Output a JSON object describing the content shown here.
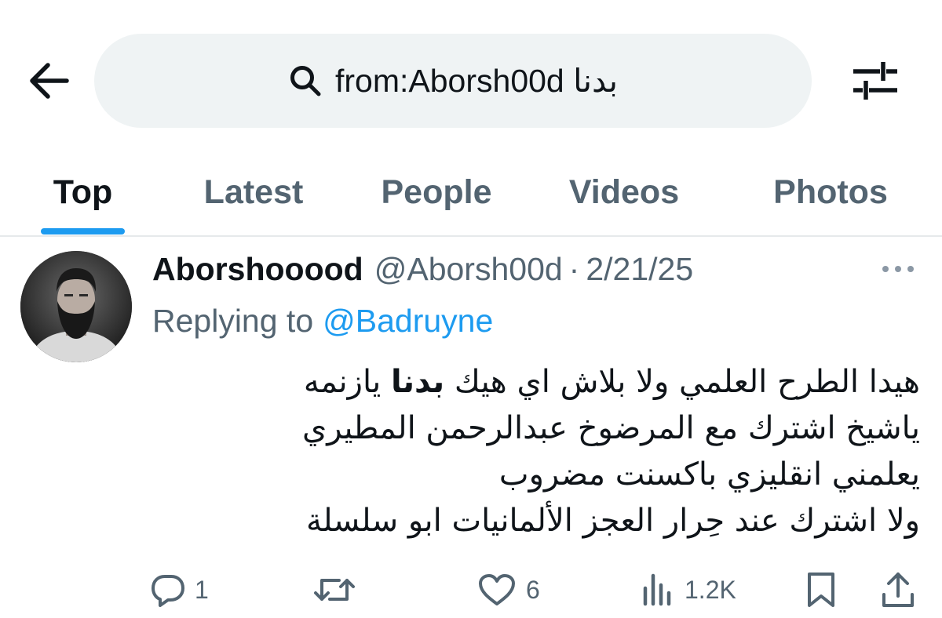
{
  "search": {
    "query_handle": "from:Aborsh00d",
    "query_keyword": "بدنا"
  },
  "tabs": [
    {
      "label": "Top",
      "active": true
    },
    {
      "label": "Latest",
      "active": false
    },
    {
      "label": "People",
      "active": false
    },
    {
      "label": "Videos",
      "active": false
    },
    {
      "label": "Photos",
      "active": false
    }
  ],
  "tweet": {
    "display_name": "Aborshooood",
    "handle": "@Aborsh00d",
    "separator": "·",
    "date": "2/21/25",
    "reply_prefix": "Replying to",
    "reply_handle": "@Badruyne",
    "lines": [
      {
        "before": "هيدا الطرح العلمي ولا بلاش اي هيك ",
        "bold": "بدنا",
        "after": " يازنمه"
      },
      {
        "before": "ياشيخ اشترك مع المرضوخ عبدالرحمن المطيري",
        "bold": "",
        "after": ""
      },
      {
        "before": "يعلمني انقليزي باكسنت مضروب",
        "bold": "",
        "after": ""
      },
      {
        "before": "ولا اشترك عند حِرار العجز الألمانيات ابو سلسلة",
        "bold": "",
        "after": ""
      }
    ],
    "actions": {
      "replies": "1",
      "retweets": "",
      "likes": "6",
      "views": "1.2K"
    }
  },
  "colors": {
    "accent": "#1d9bf0",
    "secondary_text": "#536471",
    "primary_text": "#0f1419",
    "search_bg": "#eff3f4"
  },
  "icons": {
    "back": "arrow-left-icon",
    "search": "search-icon",
    "filter": "sliders-icon",
    "more": "more-horizontal-icon",
    "reply": "comment-icon",
    "retweet": "retweet-icon",
    "like": "heart-icon",
    "views": "bar-chart-icon",
    "bookmark": "bookmark-icon",
    "share": "share-icon"
  }
}
